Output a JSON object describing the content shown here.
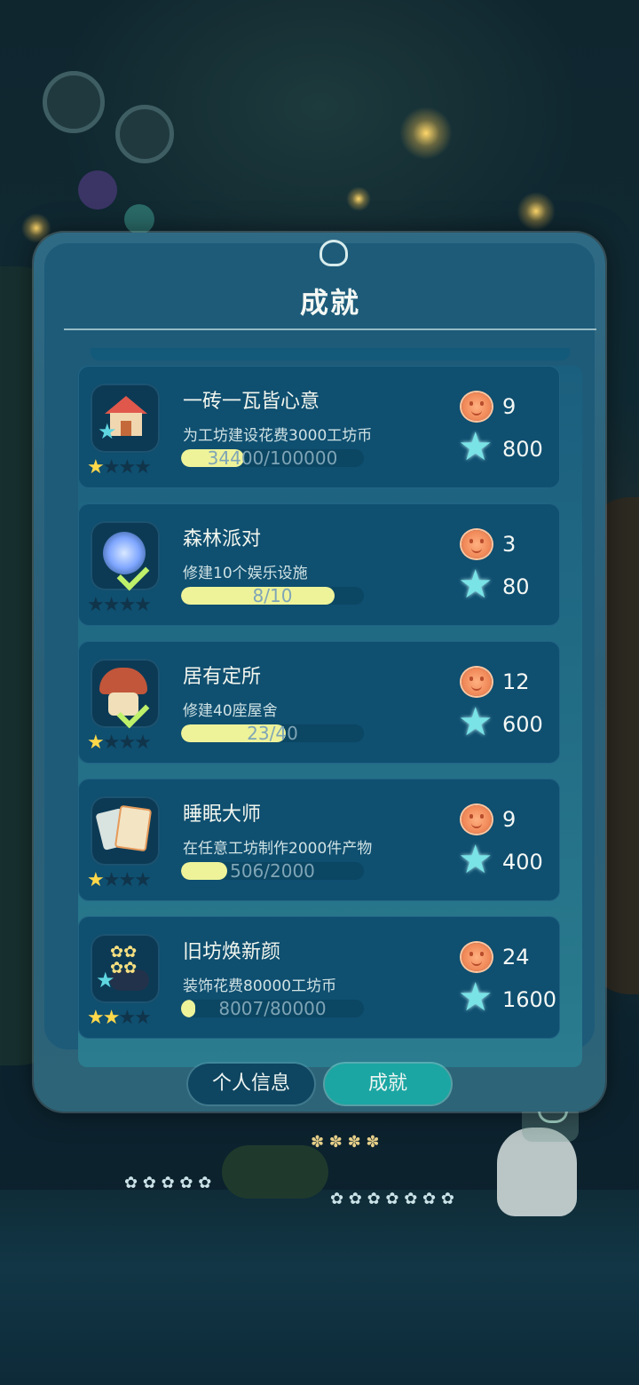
{
  "dialog": {
    "title": "成就"
  },
  "achievements": [
    {
      "name": "一砖一瓦皆心意",
      "desc": "为工坊建设花费3000工坊币",
      "progress_text": "34400/100000",
      "progress": 0.344,
      "stars_filled": 1,
      "stars_total": 4,
      "reward_coin": "9",
      "reward_star": "800",
      "icon": "workshop-house-icon"
    },
    {
      "name": "森林派对",
      "desc": "修建10个娱乐设施",
      "progress_text": "8/10",
      "progress": 0.8,
      "stars_filled": 0,
      "stars_total": 4,
      "reward_coin": "3",
      "reward_star": "80",
      "icon": "blue-lantern-check-icon"
    },
    {
      "name": "居有定所",
      "desc": "修建40座屋舍",
      "progress_text": "23/40",
      "progress": 0.575,
      "stars_filled": 1,
      "stars_total": 4,
      "reward_coin": "12",
      "reward_star": "600",
      "icon": "mushroom-house-check-icon"
    },
    {
      "name": "睡眠大师",
      "desc": "在任意工坊制作2000件产物",
      "progress_text": "506/2000",
      "progress": 0.253,
      "stars_filled": 1,
      "stars_total": 4,
      "reward_coin": "9",
      "reward_star": "400",
      "icon": "cards-icon"
    },
    {
      "name": "旧坊焕新颜",
      "desc": "装饰花费80000工坊币",
      "progress_text": "8007/80000",
      "progress": 0.1,
      "stars_filled": 2,
      "stars_total": 4,
      "reward_coin": "24",
      "reward_star": "1600",
      "icon": "flower-bush-icon"
    }
  ],
  "tabs": {
    "info": "个人信息",
    "achievements": "成就",
    "active": "achievements"
  },
  "colors": {
    "progress_fill": "#eef39a",
    "tab_active": "#1ba6a3",
    "star_filled": "#ffd84a"
  }
}
